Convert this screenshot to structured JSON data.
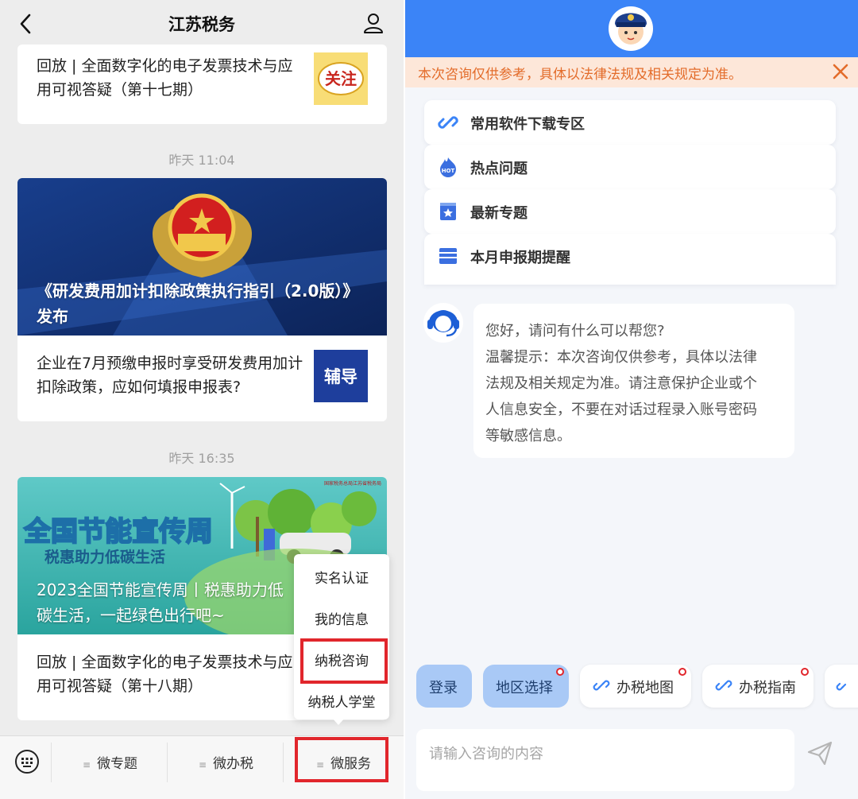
{
  "left": {
    "header": {
      "title": "江苏税务"
    },
    "articles": [
      {
        "text": "回放 | 全面数字化的电子发票技术与应用可视答疑（第十七期）",
        "thumb_label": "关注"
      },
      {
        "timestamp": "昨天 11:04",
        "banner_title": "《研发费用加计扣除政策执行指引（2.0版）》发布",
        "text": "企业在7月预缴申报时享受研发费用加计扣除政策，应如何填报申报表?",
        "thumb_label": "辅导"
      },
      {
        "timestamp": "昨天 16:35",
        "banner_heading": "全国节能宣传周",
        "banner_sub": "税惠助力低碳生活",
        "banner_logo": "国家税务总局江苏省税务局",
        "banner_title": "2023全国节能宣传周丨税惠助力低碳生活，一起绿色出行吧~",
        "text": "回放 | 全面数字化的电子发票技术与应用可视答疑（第十八期）"
      }
    ],
    "popup_menu": [
      "实名认证",
      "我的信息",
      "纳税咨询",
      "纳税人学堂"
    ],
    "bottom_tabs": [
      "微专题",
      "微办税",
      "微服务"
    ]
  },
  "right": {
    "notice": "本次咨询仅供参考，具体以法律法规及相关规定为准。",
    "menu": [
      {
        "label": "常用软件下载专区",
        "icon": "link-icon"
      },
      {
        "label": "热点问题",
        "icon": "hot-icon"
      },
      {
        "label": "最新专题",
        "icon": "star-icon"
      },
      {
        "label": "本月申报期提醒",
        "icon": "calendar-icon"
      }
    ],
    "bot_message": {
      "line1": "您好，请问有什么可以帮您?",
      "line2": "温馨提示：本次咨询仅供参考，具体以法律",
      "line3": "法规及相关规定为准。请注意保护企业或个",
      "line4": "人信息安全，不要在对话过程录入账号密码",
      "line5": "等敏感信息。"
    },
    "quick_actions": [
      "登录",
      "地区选择",
      "办税地图",
      "办税指南"
    ],
    "input_placeholder": "请输入咨询的内容"
  },
  "colors": {
    "accent_blue": "#3b84f7",
    "highlight_red": "#e1262c",
    "notice_orange": "#e36c2a"
  }
}
